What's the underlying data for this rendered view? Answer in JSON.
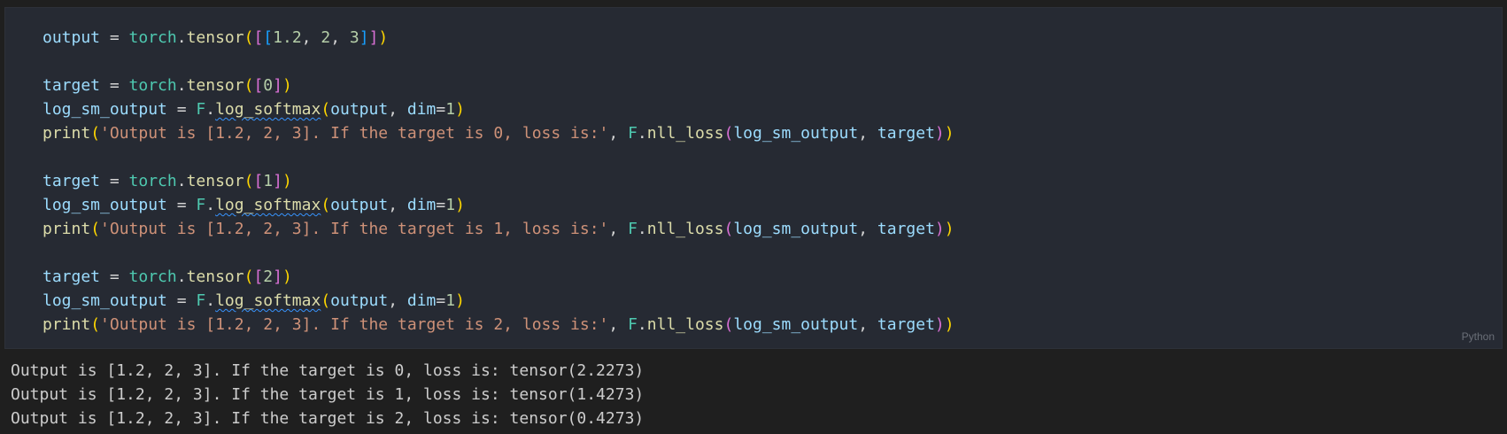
{
  "cell": {
    "language_label": "Python",
    "code_lines": [
      [
        {
          "t": "output",
          "c": "tok-var"
        },
        {
          "t": " = ",
          "c": "tok-op"
        },
        {
          "t": "torch",
          "c": "tok-module"
        },
        {
          "t": ".",
          "c": "tok-op"
        },
        {
          "t": "tensor",
          "c": "tok-func"
        },
        {
          "t": "(",
          "c": "b0"
        },
        {
          "t": "[",
          "c": "b1"
        },
        {
          "t": "[",
          "c": "b2"
        },
        {
          "t": "1.2",
          "c": "tok-num"
        },
        {
          "t": ", ",
          "c": "tok-op"
        },
        {
          "t": "2",
          "c": "tok-num"
        },
        {
          "t": ", ",
          "c": "tok-op"
        },
        {
          "t": "3",
          "c": "tok-num"
        },
        {
          "t": "]",
          "c": "b2"
        },
        {
          "t": "]",
          "c": "b1"
        },
        {
          "t": ")",
          "c": "b0"
        }
      ],
      [],
      [
        {
          "t": "target",
          "c": "tok-var"
        },
        {
          "t": " = ",
          "c": "tok-op"
        },
        {
          "t": "torch",
          "c": "tok-module"
        },
        {
          "t": ".",
          "c": "tok-op"
        },
        {
          "t": "tensor",
          "c": "tok-func"
        },
        {
          "t": "(",
          "c": "b0"
        },
        {
          "t": "[",
          "c": "b1"
        },
        {
          "t": "0",
          "c": "tok-num"
        },
        {
          "t": "]",
          "c": "b1"
        },
        {
          "t": ")",
          "c": "b0"
        }
      ],
      [
        {
          "t": "log_sm_output",
          "c": "tok-var"
        },
        {
          "t": " = ",
          "c": "tok-op"
        },
        {
          "t": "F",
          "c": "tok-module"
        },
        {
          "t": ".",
          "c": "tok-op"
        },
        {
          "t": "log_softmax",
          "c": "tok-func squiggle"
        },
        {
          "t": "(",
          "c": "b0"
        },
        {
          "t": "output",
          "c": "tok-var"
        },
        {
          "t": ", ",
          "c": "tok-op"
        },
        {
          "t": "dim",
          "c": "tok-var"
        },
        {
          "t": "=",
          "c": "tok-op"
        },
        {
          "t": "1",
          "c": "tok-num"
        },
        {
          "t": ")",
          "c": "b0"
        }
      ],
      [
        {
          "t": "print",
          "c": "tok-keyword-func"
        },
        {
          "t": "(",
          "c": "b0"
        },
        {
          "t": "'Output is [1.2, 2, 3]. If the target is 0, loss is:'",
          "c": "tok-str"
        },
        {
          "t": ", ",
          "c": "tok-op"
        },
        {
          "t": "F",
          "c": "tok-module"
        },
        {
          "t": ".",
          "c": "tok-op"
        },
        {
          "t": "nll_loss",
          "c": "tok-func"
        },
        {
          "t": "(",
          "c": "b1"
        },
        {
          "t": "log_sm_output",
          "c": "tok-var"
        },
        {
          "t": ", ",
          "c": "tok-op"
        },
        {
          "t": "target",
          "c": "tok-var"
        },
        {
          "t": ")",
          "c": "b1"
        },
        {
          "t": ")",
          "c": "b0"
        }
      ],
      [],
      [
        {
          "t": "target",
          "c": "tok-var"
        },
        {
          "t": " = ",
          "c": "tok-op"
        },
        {
          "t": "torch",
          "c": "tok-module"
        },
        {
          "t": ".",
          "c": "tok-op"
        },
        {
          "t": "tensor",
          "c": "tok-func"
        },
        {
          "t": "(",
          "c": "b0"
        },
        {
          "t": "[",
          "c": "b1"
        },
        {
          "t": "1",
          "c": "tok-num"
        },
        {
          "t": "]",
          "c": "b1"
        },
        {
          "t": ")",
          "c": "b0"
        }
      ],
      [
        {
          "t": "log_sm_output",
          "c": "tok-var"
        },
        {
          "t": " = ",
          "c": "tok-op"
        },
        {
          "t": "F",
          "c": "tok-module"
        },
        {
          "t": ".",
          "c": "tok-op"
        },
        {
          "t": "log_softmax",
          "c": "tok-func squiggle"
        },
        {
          "t": "(",
          "c": "b0"
        },
        {
          "t": "output",
          "c": "tok-var"
        },
        {
          "t": ", ",
          "c": "tok-op"
        },
        {
          "t": "dim",
          "c": "tok-var"
        },
        {
          "t": "=",
          "c": "tok-op"
        },
        {
          "t": "1",
          "c": "tok-num"
        },
        {
          "t": ")",
          "c": "b0"
        }
      ],
      [
        {
          "t": "print",
          "c": "tok-keyword-func"
        },
        {
          "t": "(",
          "c": "b0"
        },
        {
          "t": "'Output is [1.2, 2, 3]. If the target is 1, loss is:'",
          "c": "tok-str"
        },
        {
          "t": ", ",
          "c": "tok-op"
        },
        {
          "t": "F",
          "c": "tok-module"
        },
        {
          "t": ".",
          "c": "tok-op"
        },
        {
          "t": "nll_loss",
          "c": "tok-func"
        },
        {
          "t": "(",
          "c": "b1"
        },
        {
          "t": "log_sm_output",
          "c": "tok-var"
        },
        {
          "t": ", ",
          "c": "tok-op"
        },
        {
          "t": "target",
          "c": "tok-var"
        },
        {
          "t": ")",
          "c": "b1"
        },
        {
          "t": ")",
          "c": "b0"
        }
      ],
      [],
      [
        {
          "t": "target",
          "c": "tok-var"
        },
        {
          "t": " = ",
          "c": "tok-op"
        },
        {
          "t": "torch",
          "c": "tok-module"
        },
        {
          "t": ".",
          "c": "tok-op"
        },
        {
          "t": "tensor",
          "c": "tok-func"
        },
        {
          "t": "(",
          "c": "b0"
        },
        {
          "t": "[",
          "c": "b1"
        },
        {
          "t": "2",
          "c": "tok-num"
        },
        {
          "t": "]",
          "c": "b1"
        },
        {
          "t": ")",
          "c": "b0"
        }
      ],
      [
        {
          "t": "log_sm_output",
          "c": "tok-var"
        },
        {
          "t": " = ",
          "c": "tok-op"
        },
        {
          "t": "F",
          "c": "tok-module"
        },
        {
          "t": ".",
          "c": "tok-op"
        },
        {
          "t": "log_softmax",
          "c": "tok-func squiggle"
        },
        {
          "t": "(",
          "c": "b0"
        },
        {
          "t": "output",
          "c": "tok-var"
        },
        {
          "t": ", ",
          "c": "tok-op"
        },
        {
          "t": "dim",
          "c": "tok-var"
        },
        {
          "t": "=",
          "c": "tok-op"
        },
        {
          "t": "1",
          "c": "tok-num"
        },
        {
          "t": ")",
          "c": "b0"
        }
      ],
      [
        {
          "t": "print",
          "c": "tok-keyword-func"
        },
        {
          "t": "(",
          "c": "b0"
        },
        {
          "t": "'Output is [1.2, 2, 3]. If the target is 2, loss is:'",
          "c": "tok-str"
        },
        {
          "t": ", ",
          "c": "tok-op"
        },
        {
          "t": "F",
          "c": "tok-module"
        },
        {
          "t": ".",
          "c": "tok-op"
        },
        {
          "t": "nll_loss",
          "c": "tok-func"
        },
        {
          "t": "(",
          "c": "b1"
        },
        {
          "t": "log_sm_output",
          "c": "tok-var"
        },
        {
          "t": ", ",
          "c": "tok-op"
        },
        {
          "t": "target",
          "c": "tok-var"
        },
        {
          "t": ")",
          "c": "b1"
        },
        {
          "t": ")",
          "c": "b0"
        }
      ]
    ]
  },
  "output": {
    "lines": [
      "Output is [1.2, 2, 3]. If the target is 0, loss is: tensor(2.2273)",
      "Output is [1.2, 2, 3]. If the target is 1, loss is: tensor(1.4273)",
      "Output is [1.2, 2, 3]. If the target is 2, loss is: tensor(0.4273)"
    ]
  },
  "colors": {
    "background": "#1f1f1f",
    "cell_background": "#262a33",
    "string": "#ce9178",
    "function": "#dcdcaa",
    "module": "#4ec9b0",
    "variable": "#9cdcfe",
    "number": "#b5cea8"
  }
}
